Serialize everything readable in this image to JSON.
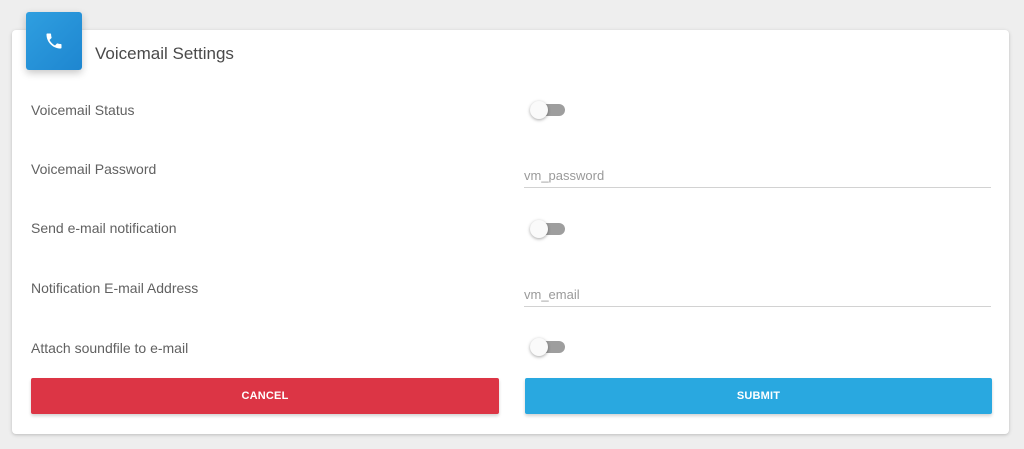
{
  "header": {
    "title": "Voicemail Settings",
    "icon": "phone-icon",
    "icon_bg": "#2196d9"
  },
  "form": {
    "voicemail_status": {
      "label": "Voicemail Status",
      "enabled": false
    },
    "voicemail_password": {
      "label": "Voicemail Password",
      "placeholder": "vm_password",
      "value": ""
    },
    "send_email_notification": {
      "label": "Send e-mail notification",
      "enabled": false
    },
    "notification_email": {
      "label": "Notification E-mail Address",
      "placeholder": "vm_email",
      "value": ""
    },
    "attach_soundfile": {
      "label": "Attach soundfile to e-mail",
      "enabled": false
    }
  },
  "actions": {
    "cancel_label": "CANCEL",
    "submit_label": "SUBMIT",
    "cancel_color": "#dc3545",
    "submit_color": "#29a8e0"
  }
}
